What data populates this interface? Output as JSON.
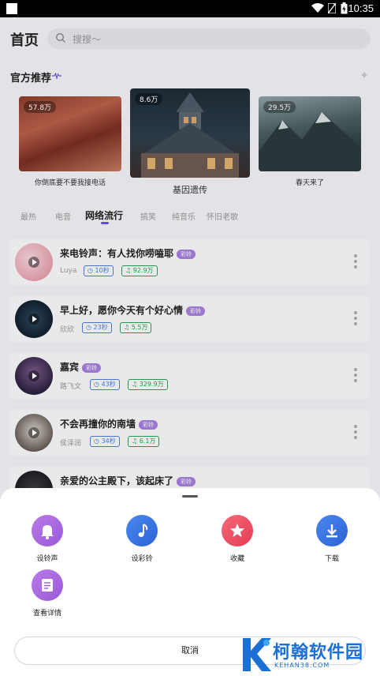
{
  "status_bar": {
    "time": "10:35"
  },
  "header": {
    "title": "首页",
    "search_placeholder": "搜搜～"
  },
  "section": {
    "title": "官方推荐"
  },
  "featured": [
    {
      "badge": "57.8万",
      "caption": "你倒底要不要我接电话"
    },
    {
      "badge": "8.6万",
      "caption": "基因遗传"
    },
    {
      "badge": "29.5万",
      "caption": "春天来了"
    }
  ],
  "tabs": [
    {
      "label": "最热",
      "active": false
    },
    {
      "label": "电音",
      "active": false
    },
    {
      "label": "网络流行",
      "active": true
    },
    {
      "label": "搞笑",
      "active": false
    },
    {
      "label": "纯音乐",
      "active": false
    },
    {
      "label": "怀旧老歌",
      "active": false
    }
  ],
  "songs": [
    {
      "title": "来电铃声：有人找你唠嗑耶",
      "tag": "彩铃",
      "artist": "Luya",
      "duration": "10秒",
      "plays": "92.9万"
    },
    {
      "title": "早上好，愿你今天有个好心情",
      "tag": "彩铃",
      "artist": "欣欣",
      "duration": "23秒",
      "plays": "5.5万"
    },
    {
      "title": "嘉宾",
      "tag": "彩铃",
      "artist": "路飞文",
      "duration": "43秒",
      "plays": "329.9万"
    },
    {
      "title": "不会再撞你的南墙",
      "tag": "彩铃",
      "artist": "侯泽润",
      "duration": "34秒",
      "plays": "6.1万"
    },
    {
      "title": "亲爱的公主殿下，该起床了",
      "tag": "彩铃"
    }
  ],
  "sheet": {
    "actions": [
      {
        "label": "设铃声",
        "icon": "bell-icon",
        "color": "#a468e0"
      },
      {
        "label": "设彩铃",
        "icon": "music-note-icon",
        "color": "#2f6fe0"
      },
      {
        "label": "收藏",
        "icon": "star-icon",
        "color": "#ef4f63"
      },
      {
        "label": "下载",
        "icon": "download-icon",
        "color": "#2f6fe0"
      },
      {
        "label": "查看详情",
        "icon": "details-icon",
        "color": "#a468e0"
      }
    ],
    "cancel": "取消"
  },
  "watermark": {
    "title": "柯翰软件园",
    "url": "KEHAN38.COM"
  },
  "colors": {
    "accent": "#6a59d8",
    "tag": "#a77fd8",
    "duration": "#4a7ed6",
    "plays": "#2f9e53"
  }
}
